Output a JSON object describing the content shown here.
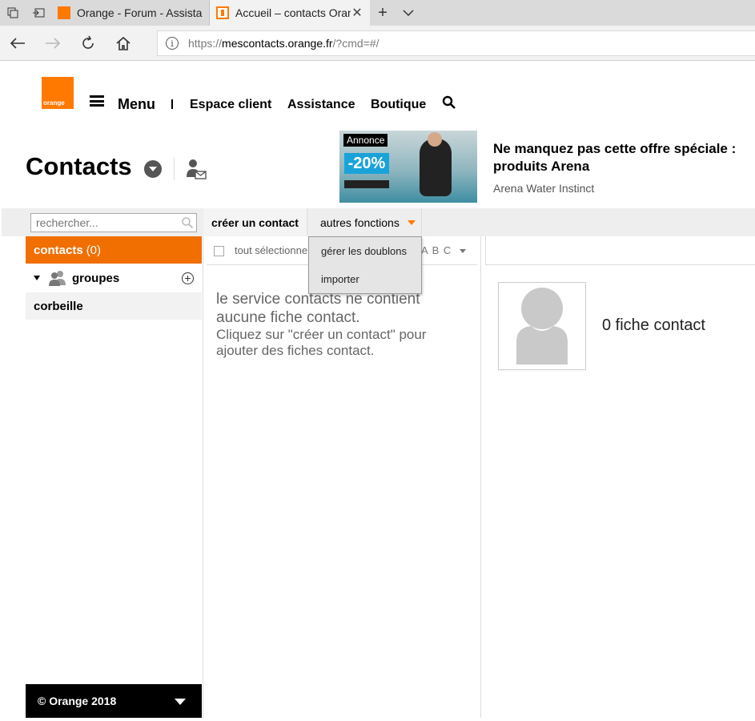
{
  "browser": {
    "tabs": [
      {
        "title": "Orange - Forum - Assistanc"
      },
      {
        "title": "Accueil – contacts Oran"
      }
    ],
    "address": {
      "prefix": "https://",
      "domain": "mescontacts.orange.fr",
      "path": "/?cmd=#/"
    }
  },
  "header": {
    "logo_text": "orange",
    "menu_label": "Menu",
    "nav": [
      "Espace client",
      "Assistance",
      "Boutique"
    ]
  },
  "page": {
    "title": "Contacts"
  },
  "ad": {
    "badge": "Annonce",
    "promo": "-20%",
    "title": "Ne manquez pas cette offre spéciale : produits Arena",
    "subtitle": "Arena Water Instinct"
  },
  "toolbar": {
    "search_placeholder": "rechercher...",
    "create_label": "créer un contact",
    "more_label": "autres fonctions"
  },
  "dropdown": {
    "items": [
      "gérer les doublons",
      "importer"
    ]
  },
  "sidebar": {
    "contacts_label": "contacts",
    "contacts_count": "(0)",
    "groups_label": "groupes",
    "trash_label": "corbeille",
    "footer": "© Orange 2018"
  },
  "list": {
    "select_all": "tout sélectionner",
    "abc": "A B C",
    "empty_title": "le service contacts ne contient aucune fiche contact.",
    "empty_hint": "Cliquez sur \"créer un contact\" pour ajouter des fiches contact."
  },
  "detail": {
    "count_label": "0 fiche contact"
  },
  "colors": {
    "brand": "#ff7900",
    "sidebar_active": "#f16e00"
  }
}
